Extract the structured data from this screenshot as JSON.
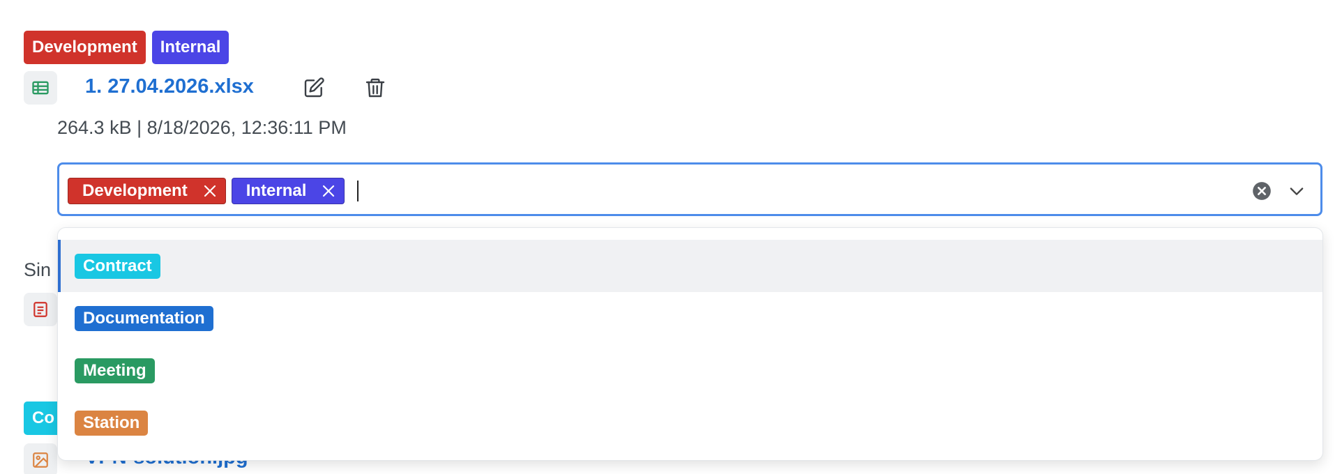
{
  "file": {
    "tags": [
      {
        "label": "Development",
        "color": "#d0332b"
      },
      {
        "label": "Internal",
        "color": "#4b45e6"
      }
    ],
    "name": "1. 27.04.2026.xlsx",
    "meta": "264.3 kB | 8/18/2026, 12:36:11 PM",
    "icon": "spreadsheet-icon",
    "actions": [
      {
        "icon": "edit-icon"
      },
      {
        "icon": "trash-icon"
      }
    ]
  },
  "tag_select": {
    "selected": [
      {
        "label": "Development",
        "color": "#d0332b"
      },
      {
        "label": "Internal",
        "color": "#4b45e6"
      }
    ],
    "input_value": "",
    "clear_icon": "clear-circle-icon",
    "toggle_icon": "chevron-down-icon",
    "options": [
      {
        "label": "Contract",
        "color": "#19c7e3"
      },
      {
        "label": "Documentation",
        "color": "#1f6fd1"
      },
      {
        "label": "Meeting",
        "color": "#2a9a62"
      },
      {
        "label": "Station",
        "color": "#db8442"
      }
    ]
  },
  "background": {
    "partial_text": "Sin",
    "partial_tag": "Co",
    "partial_link": "VPN-solution.jpg",
    "icons": [
      "document-icon",
      "image-icon"
    ]
  }
}
